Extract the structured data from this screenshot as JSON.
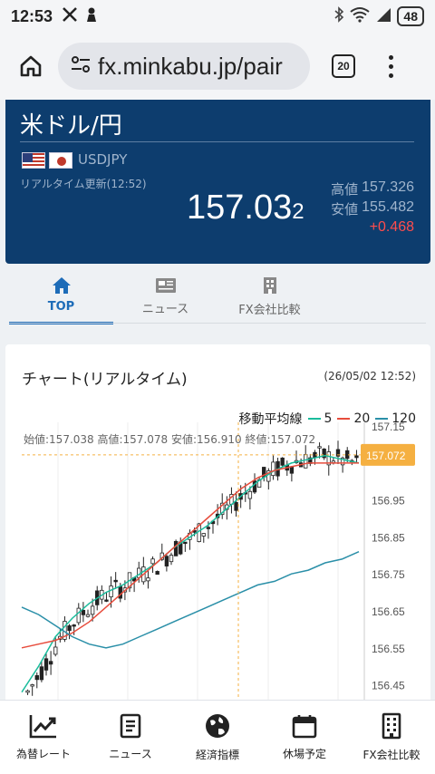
{
  "status_bar": {
    "time": "12:53",
    "battery": "48"
  },
  "browser": {
    "url": "fx.minkabu.jp/pair",
    "tab_count": "20"
  },
  "rate": {
    "pair_name": "米ドル/円",
    "symbol": "USDJPY",
    "update_time": "リアルタイム更新(12:52)",
    "price_main": "157.03",
    "price_last_digit": "2",
    "high_label": "高値",
    "high_value": "157.326",
    "low_label": "安値",
    "low_value": "155.482",
    "change": "+0.468"
  },
  "tabs": [
    {
      "label": "TOP",
      "icon": "home-icon",
      "active": true
    },
    {
      "label": "ニュース",
      "icon": "newspaper-icon",
      "active": false
    },
    {
      "label": "FX会社比較",
      "icon": "building-icon",
      "active": false
    }
  ],
  "chart": {
    "title": "チャート(リアルタイム)",
    "datetime": "(26/05/02 12:52)",
    "legend_label": "移動平均線",
    "ohlc_text": "始値:157.038 高値:157.078 安値:156.910 終値:157.072",
    "current_price_label": "157.072",
    "colors": {
      "ma5": "#1abc9c",
      "ma20": "#e74c3c",
      "ma120": "#2a8fa8",
      "up": "#ffffff",
      "down": "#222222",
      "marker": "#f5b041"
    }
  },
  "chart_data": {
    "type": "candlestick",
    "y_ticks": [
      "157.15",
      "156.95",
      "156.85",
      "156.75",
      "156.65",
      "156.55",
      "156.45"
    ],
    "ylim": [
      156.39,
      157.16
    ],
    "current_price": 157.072,
    "series": [
      {
        "name": "5",
        "values": [
          156.43,
          156.5,
          156.58,
          156.63,
          156.67,
          156.7,
          156.72,
          156.75,
          156.78,
          156.82,
          156.85,
          156.88,
          156.92,
          156.96,
          157.0,
          157.03,
          157.05,
          157.06,
          157.07,
          157.06,
          157.05
        ]
      },
      {
        "name": "20",
        "values": [
          156.55,
          156.56,
          156.57,
          156.59,
          156.62,
          156.66,
          156.7,
          156.74,
          156.78,
          156.82,
          156.86,
          156.9,
          156.94,
          156.98,
          157.01,
          157.03,
          157.04,
          157.05,
          157.05,
          157.05,
          157.05
        ]
      },
      {
        "name": "120",
        "values": [
          156.66,
          156.64,
          156.61,
          156.58,
          156.56,
          156.55,
          156.56,
          156.58,
          156.6,
          156.62,
          156.64,
          156.66,
          156.68,
          156.7,
          156.72,
          156.73,
          156.75,
          156.76,
          156.78,
          156.79,
          156.81
        ]
      }
    ]
  },
  "bottom_nav": [
    {
      "label": "為替レート",
      "icon": "chart-trend-icon"
    },
    {
      "label": "ニュース",
      "icon": "document-icon"
    },
    {
      "label": "経済指標",
      "icon": "globe-icon"
    },
    {
      "label": "休場予定",
      "icon": "calendar-icon"
    },
    {
      "label": "FX会社比較",
      "icon": "building-icon"
    }
  ]
}
